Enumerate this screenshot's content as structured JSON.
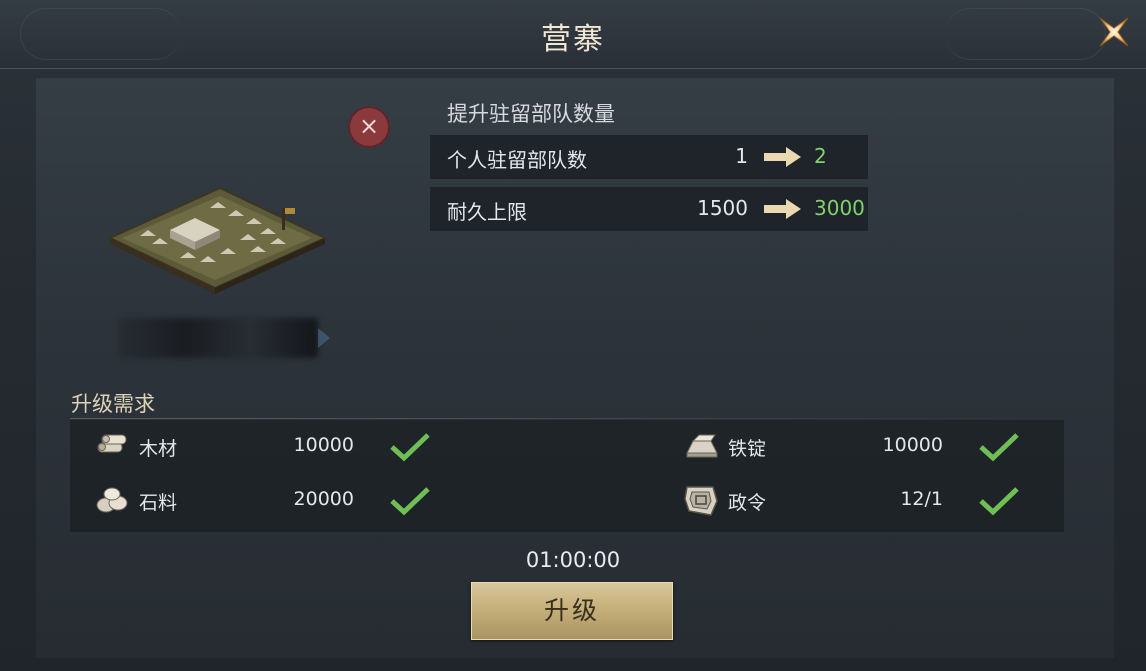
{
  "header": {
    "title": "营寨"
  },
  "building": {
    "upgrade_heading": "提升驻留部队数量",
    "stats": [
      {
        "label": "个人驻留部队数",
        "current": "1",
        "next": "2"
      },
      {
        "label": "耐久上限",
        "current": "1500",
        "next": "3000"
      }
    ]
  },
  "requirements": {
    "title": "升级需求",
    "items": [
      {
        "name": "木材",
        "value": "10000",
        "icon": "wood-icon",
        "met": true
      },
      {
        "name": "铁锭",
        "value": "10000",
        "icon": "iron-ingot-icon",
        "met": true
      },
      {
        "name": "石料",
        "value": "20000",
        "icon": "stone-icon",
        "met": true
      },
      {
        "name": "政令",
        "value": "12/1",
        "icon": "decree-icon",
        "met": true
      }
    ]
  },
  "timer": "01:00:00",
  "actions": {
    "upgrade_label": "升级"
  },
  "colors": {
    "accent_green": "#7fd36a",
    "gold_button": "#c3ad78",
    "title_text": "#f0e6d2",
    "badge_red": "#8a3a3c"
  }
}
